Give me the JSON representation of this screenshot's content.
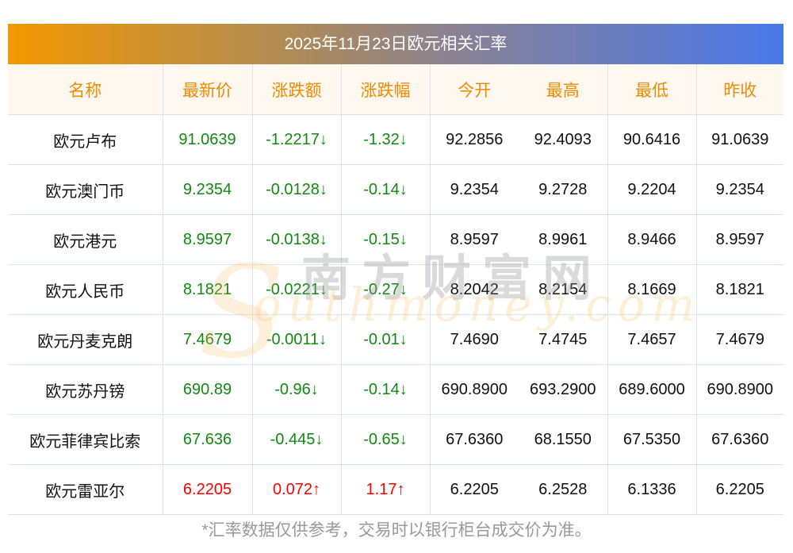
{
  "title": "2025年11月23日欧元相关汇率",
  "headers": [
    "名称",
    "最新价",
    "涨跌额",
    "涨跌幅",
    "今开",
    "最高",
    "最低",
    "昨收"
  ],
  "rows": [
    {
      "name": "欧元卢布",
      "last": "91.0639",
      "chg": "-1.2217↓",
      "pct": "-1.32↓",
      "open": "92.2856",
      "high": "92.4093",
      "low": "90.6416",
      "prev": "91.0639",
      "dir": "down"
    },
    {
      "name": "欧元澳门币",
      "last": "9.2354",
      "chg": "-0.0128↓",
      "pct": "-0.14↓",
      "open": "9.2354",
      "high": "9.2728",
      "low": "9.2204",
      "prev": "9.2354",
      "dir": "down"
    },
    {
      "name": "欧元港元",
      "last": "8.9597",
      "chg": "-0.0138↓",
      "pct": "-0.15↓",
      "open": "8.9597",
      "high": "8.9961",
      "low": "8.9466",
      "prev": "8.9597",
      "dir": "down"
    },
    {
      "name": "欧元人民币",
      "last": "8.1821",
      "chg": "-0.0221↓",
      "pct": "-0.27↓",
      "open": "8.2042",
      "high": "8.2154",
      "low": "8.1669",
      "prev": "8.1821",
      "dir": "down"
    },
    {
      "name": "欧元丹麦克朗",
      "last": "7.4679",
      "chg": "-0.0011↓",
      "pct": "-0.01↓",
      "open": "7.4690",
      "high": "7.4745",
      "low": "7.4657",
      "prev": "7.4679",
      "dir": "down"
    },
    {
      "name": "欧元苏丹镑",
      "last": "690.89",
      "chg": "-0.96↓",
      "pct": "-0.14↓",
      "open": "690.8900",
      "high": "693.2900",
      "low": "689.6000",
      "prev": "690.8900",
      "dir": "down"
    },
    {
      "name": "欧元菲律宾比索",
      "last": "67.636",
      "chg": "-0.445↓",
      "pct": "-0.65↓",
      "open": "67.6360",
      "high": "68.1550",
      "low": "67.5350",
      "prev": "67.6360",
      "dir": "down"
    },
    {
      "name": "欧元雷亚尔",
      "last": "6.2205",
      "chg": "0.072↑",
      "pct": "1.17↑",
      "open": "6.2205",
      "high": "6.2528",
      "low": "6.1336",
      "prev": "6.2205",
      "dir": "up"
    }
  ],
  "watermark": {
    "cn": "南方财富网",
    "en": "outhmoney.com",
    "s": "S"
  },
  "footer": "*汇率数据仅供参考，交易时以银行柜台成交价为准。"
}
